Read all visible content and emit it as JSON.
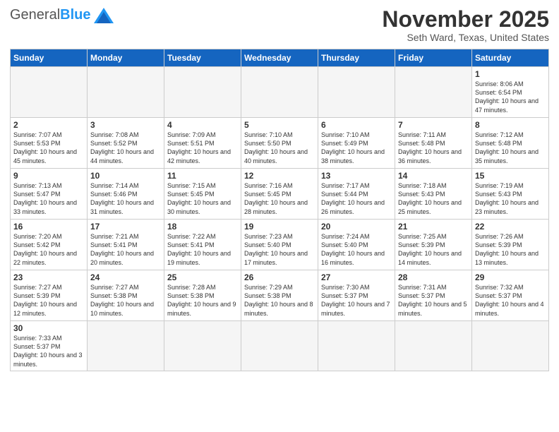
{
  "logo": {
    "general": "General",
    "blue": "Blue"
  },
  "title": "November 2025",
  "subtitle": "Seth Ward, Texas, United States",
  "days_of_week": [
    "Sunday",
    "Monday",
    "Tuesday",
    "Wednesday",
    "Thursday",
    "Friday",
    "Saturday"
  ],
  "weeks": [
    [
      {
        "day": "",
        "info": "",
        "empty": true
      },
      {
        "day": "",
        "info": "",
        "empty": true
      },
      {
        "day": "",
        "info": "",
        "empty": true
      },
      {
        "day": "",
        "info": "",
        "empty": true
      },
      {
        "day": "",
        "info": "",
        "empty": true
      },
      {
        "day": "",
        "info": "",
        "empty": true
      },
      {
        "day": "1",
        "info": "Sunrise: 8:06 AM\nSunset: 6:54 PM\nDaylight: 10 hours and 47 minutes."
      }
    ],
    [
      {
        "day": "2",
        "info": "Sunrise: 7:07 AM\nSunset: 5:53 PM\nDaylight: 10 hours and 45 minutes."
      },
      {
        "day": "3",
        "info": "Sunrise: 7:08 AM\nSunset: 5:52 PM\nDaylight: 10 hours and 44 minutes."
      },
      {
        "day": "4",
        "info": "Sunrise: 7:09 AM\nSunset: 5:51 PM\nDaylight: 10 hours and 42 minutes."
      },
      {
        "day": "5",
        "info": "Sunrise: 7:10 AM\nSunset: 5:50 PM\nDaylight: 10 hours and 40 minutes."
      },
      {
        "day": "6",
        "info": "Sunrise: 7:10 AM\nSunset: 5:49 PM\nDaylight: 10 hours and 38 minutes."
      },
      {
        "day": "7",
        "info": "Sunrise: 7:11 AM\nSunset: 5:48 PM\nDaylight: 10 hours and 36 minutes."
      },
      {
        "day": "8",
        "info": "Sunrise: 7:12 AM\nSunset: 5:48 PM\nDaylight: 10 hours and 35 minutes."
      }
    ],
    [
      {
        "day": "9",
        "info": "Sunrise: 7:13 AM\nSunset: 5:47 PM\nDaylight: 10 hours and 33 minutes."
      },
      {
        "day": "10",
        "info": "Sunrise: 7:14 AM\nSunset: 5:46 PM\nDaylight: 10 hours and 31 minutes."
      },
      {
        "day": "11",
        "info": "Sunrise: 7:15 AM\nSunset: 5:45 PM\nDaylight: 10 hours and 30 minutes."
      },
      {
        "day": "12",
        "info": "Sunrise: 7:16 AM\nSunset: 5:45 PM\nDaylight: 10 hours and 28 minutes."
      },
      {
        "day": "13",
        "info": "Sunrise: 7:17 AM\nSunset: 5:44 PM\nDaylight: 10 hours and 26 minutes."
      },
      {
        "day": "14",
        "info": "Sunrise: 7:18 AM\nSunset: 5:43 PM\nDaylight: 10 hours and 25 minutes."
      },
      {
        "day": "15",
        "info": "Sunrise: 7:19 AM\nSunset: 5:43 PM\nDaylight: 10 hours and 23 minutes."
      }
    ],
    [
      {
        "day": "16",
        "info": "Sunrise: 7:20 AM\nSunset: 5:42 PM\nDaylight: 10 hours and 22 minutes."
      },
      {
        "day": "17",
        "info": "Sunrise: 7:21 AM\nSunset: 5:41 PM\nDaylight: 10 hours and 20 minutes."
      },
      {
        "day": "18",
        "info": "Sunrise: 7:22 AM\nSunset: 5:41 PM\nDaylight: 10 hours and 19 minutes."
      },
      {
        "day": "19",
        "info": "Sunrise: 7:23 AM\nSunset: 5:40 PM\nDaylight: 10 hours and 17 minutes."
      },
      {
        "day": "20",
        "info": "Sunrise: 7:24 AM\nSunset: 5:40 PM\nDaylight: 10 hours and 16 minutes."
      },
      {
        "day": "21",
        "info": "Sunrise: 7:25 AM\nSunset: 5:39 PM\nDaylight: 10 hours and 14 minutes."
      },
      {
        "day": "22",
        "info": "Sunrise: 7:26 AM\nSunset: 5:39 PM\nDaylight: 10 hours and 13 minutes."
      }
    ],
    [
      {
        "day": "23",
        "info": "Sunrise: 7:27 AM\nSunset: 5:39 PM\nDaylight: 10 hours and 12 minutes."
      },
      {
        "day": "24",
        "info": "Sunrise: 7:27 AM\nSunset: 5:38 PM\nDaylight: 10 hours and 10 minutes."
      },
      {
        "day": "25",
        "info": "Sunrise: 7:28 AM\nSunset: 5:38 PM\nDaylight: 10 hours and 9 minutes."
      },
      {
        "day": "26",
        "info": "Sunrise: 7:29 AM\nSunset: 5:38 PM\nDaylight: 10 hours and 8 minutes."
      },
      {
        "day": "27",
        "info": "Sunrise: 7:30 AM\nSunset: 5:37 PM\nDaylight: 10 hours and 7 minutes."
      },
      {
        "day": "28",
        "info": "Sunrise: 7:31 AM\nSunset: 5:37 PM\nDaylight: 10 hours and 5 minutes."
      },
      {
        "day": "29",
        "info": "Sunrise: 7:32 AM\nSunset: 5:37 PM\nDaylight: 10 hours and 4 minutes."
      }
    ],
    [
      {
        "day": "30",
        "info": "Sunrise: 7:33 AM\nSunset: 5:37 PM\nDaylight: 10 hours and 3 minutes."
      },
      {
        "day": "",
        "info": "",
        "empty": true
      },
      {
        "day": "",
        "info": "",
        "empty": true
      },
      {
        "day": "",
        "info": "",
        "empty": true
      },
      {
        "day": "",
        "info": "",
        "empty": true
      },
      {
        "day": "",
        "info": "",
        "empty": true
      },
      {
        "day": "",
        "info": "",
        "empty": true
      }
    ]
  ]
}
